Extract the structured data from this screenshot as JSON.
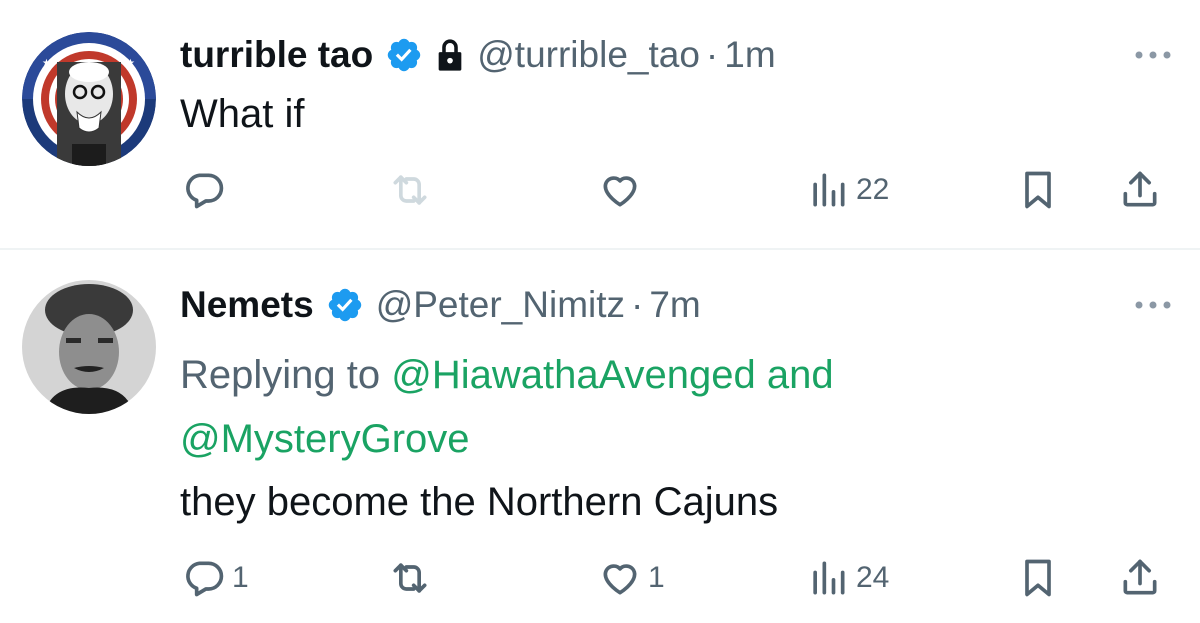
{
  "tweets": [
    {
      "author_name": "turrible tao",
      "handle": "@turrible_tao",
      "separator": "·",
      "time": "1m",
      "verified": true,
      "protected": true,
      "text": "What if",
      "actions": {
        "reply_count": "",
        "retweet_count": "",
        "like_count": "",
        "views_count": "22"
      }
    },
    {
      "author_name": "Nemets",
      "handle": "@Peter_Nimitz",
      "separator": "·",
      "time": "7m",
      "verified": true,
      "replying_prefix": "Replying to ",
      "mention_1": "@HiawathaAvenged",
      "mention_join": " and",
      "mention_2": "@MysteryGrove",
      "text": "they become the Northern Cajuns",
      "actions": {
        "reply_count": "1",
        "retweet_count": "",
        "like_count": "1",
        "views_count": "24"
      }
    }
  ],
  "colors": {
    "verified_badge": "#1d9bf0",
    "mention": "#1aa363",
    "muted_text": "#536471",
    "icon": "#536471"
  },
  "icons": {
    "reply": "reply-icon",
    "retweet": "retweet-icon",
    "like": "heart-icon",
    "views": "views-icon",
    "bookmark": "bookmark-icon",
    "share": "share-icon",
    "more": "more-icon",
    "verified": "verified-badge-icon",
    "lock": "lock-icon"
  }
}
